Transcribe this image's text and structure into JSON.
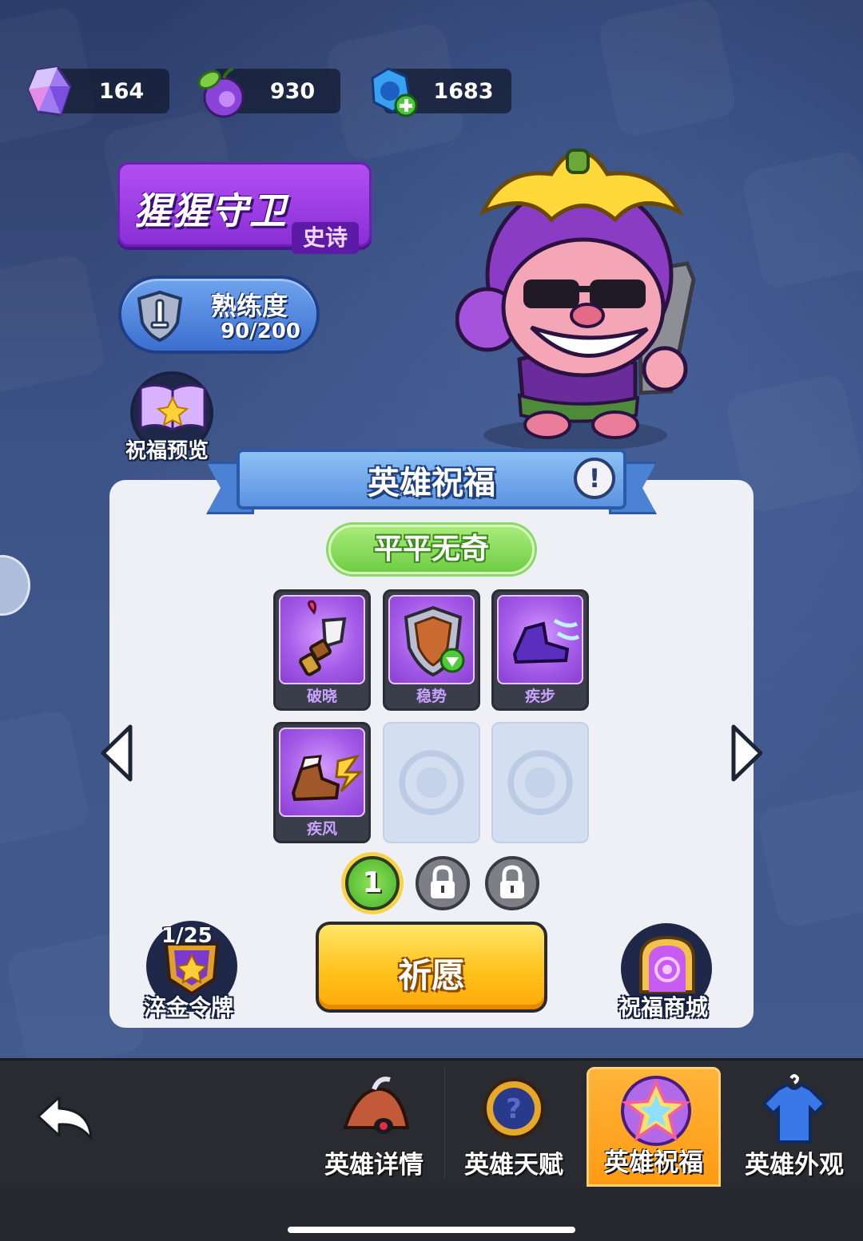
{
  "currencies": [
    {
      "icon": "crystal-icon",
      "value": "164"
    },
    {
      "icon": "magic-fruit-icon",
      "value": "930"
    },
    {
      "icon": "blue-gem-plus-icon",
      "value": "1683"
    }
  ],
  "hero": {
    "name": "猩猩守卫",
    "rarity": "史诗"
  },
  "proficiency": {
    "label": "熟练度",
    "value": "90/200"
  },
  "blessing_preview": {
    "label": "祝福预览"
  },
  "panel": {
    "title": "英雄祝福",
    "info_icon": "!",
    "tier": "平平无奇",
    "cards": [
      {
        "label": "破晓",
        "icon": "dagger-icon"
      },
      {
        "label": "稳势",
        "icon": "shield-icon"
      },
      {
        "label": "疾步",
        "icon": "dash-boot-icon"
      },
      {
        "label": "疾风",
        "icon": "wind-boot-icon"
      }
    ],
    "empty_slots": 2,
    "pages": [
      {
        "label": "1",
        "state": "active"
      },
      {
        "label": "",
        "state": "locked"
      },
      {
        "label": "",
        "state": "locked"
      }
    ],
    "medal": {
      "count": "1/25",
      "label": "淬金令牌"
    },
    "pray_button": "祈愿",
    "shop": {
      "label": "祝福商城"
    }
  },
  "tabs": [
    {
      "label": "英雄详情",
      "icon": "hero-hat-icon",
      "active": false
    },
    {
      "label": "英雄天赋",
      "icon": "talent-medal-icon",
      "active": false
    },
    {
      "label": "英雄祝福",
      "icon": "blessing-star-icon",
      "active": true
    },
    {
      "label": "英雄外观",
      "icon": "tshirt-icon",
      "active": false
    }
  ],
  "colors": {
    "background": "#3e5488",
    "hero_plate": "#9a3ee0",
    "tier_green": "#7fd650",
    "pray_yellow": "#ffc21c",
    "active_tab": "#ff9a12"
  }
}
